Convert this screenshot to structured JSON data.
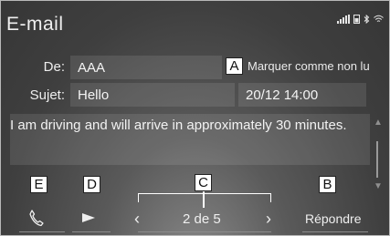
{
  "header": {
    "title": "E-mail"
  },
  "status_icons": [
    "signal-icon",
    "phone-battery-icon",
    "bluetooth-icon",
    "wifi-icon"
  ],
  "fields": {
    "from_label": "De:",
    "from_value": "AAA",
    "subject_label": "Sujet:",
    "subject_value": "Hello",
    "datetime": "20/12 14:00"
  },
  "actions": {
    "mark_unread": "Marquer comme non lu",
    "reply": "Répondre",
    "pager": "2 de 5"
  },
  "message": {
    "body": "I am driving and will arrive in approximately 30 minutes."
  },
  "callouts": {
    "a": "A",
    "b": "B",
    "c": "C",
    "d": "D",
    "e": "E"
  }
}
